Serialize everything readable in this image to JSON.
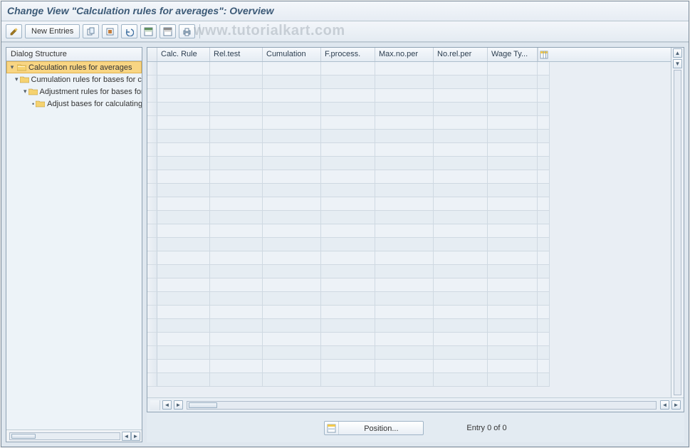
{
  "title": "Change View \"Calculation rules for averages\": Overview",
  "watermark": "www.tutorialkart.com",
  "toolbar": {
    "new_entries_label": "New Entries"
  },
  "sidebar": {
    "header": "Dialog Structure",
    "items": [
      {
        "label": "Calculation rules for averages",
        "selected": true,
        "open": true
      },
      {
        "label": "Cumulation rules for bases for calculating average",
        "selected": false,
        "open": true
      },
      {
        "label": "Adjustment rules for bases for calculating averages",
        "selected": false,
        "open": true
      },
      {
        "label": "Adjust bases for calculating average value",
        "selected": false,
        "open": false
      }
    ]
  },
  "table": {
    "columns": [
      "Calc. Rule",
      "Rel.test",
      "Cumulation",
      "F.process.",
      "Max.no.per",
      "No.rel.per",
      "Wage Ty..."
    ],
    "empty_row_count": 24
  },
  "footer": {
    "position_label": "Position...",
    "entry_text": "Entry 0 of 0"
  },
  "colors": {
    "accent": "#3c5a77",
    "selection": "#f8d583",
    "grid_border": "#c6d1dc"
  }
}
